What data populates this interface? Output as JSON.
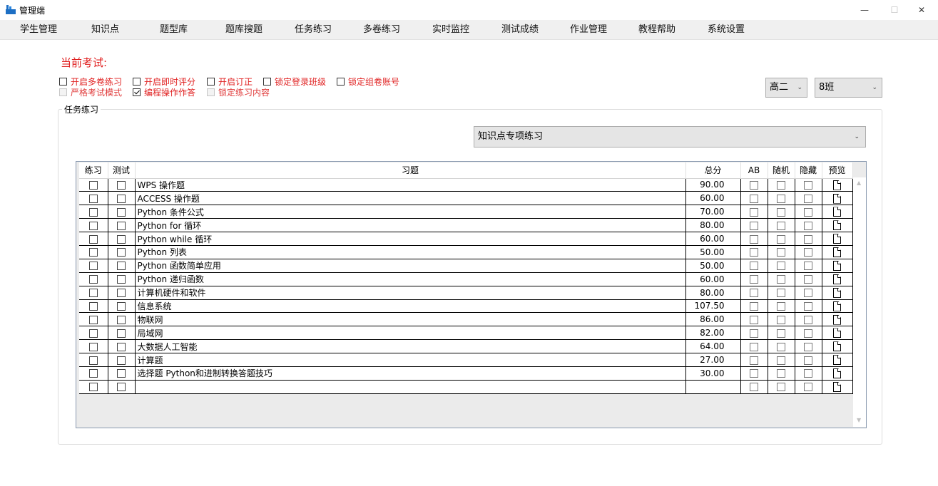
{
  "window": {
    "title": "管理端",
    "icon": "app-logo-icon",
    "min_glyph": "—",
    "max_glyph": "☐",
    "close_glyph": "✕"
  },
  "menu": [
    "学生管理",
    "知识点",
    "题型库",
    "题库搜题",
    "任务练习",
    "多卷练习",
    "实时监控",
    "测试成绩",
    "作业管理",
    "教程帮助",
    "系统设置"
  ],
  "exam": {
    "label": "当前考试:"
  },
  "options": [
    {
      "label": "开启多卷练习",
      "checked": false,
      "disabled": false
    },
    {
      "label": "开启即时评分",
      "checked": false,
      "disabled": false
    },
    {
      "label": "开启订正",
      "checked": false,
      "disabled": false
    },
    {
      "label": "锁定登录班级",
      "checked": false,
      "disabled": false
    },
    {
      "label": "锁定组卷账号",
      "checked": false,
      "disabled": false
    },
    {
      "label": "严格考试模式",
      "checked": false,
      "disabled": true
    },
    {
      "label": "编程操作作答",
      "checked": true,
      "disabled": false
    },
    {
      "label": "锁定练习内容",
      "checked": false,
      "disabled": true
    }
  ],
  "grade_select": {
    "value": "高二",
    "arrow": "⌄"
  },
  "class_select": {
    "value": "8班",
    "arrow": "⌄"
  },
  "group": {
    "title": "任务练习"
  },
  "type_select": {
    "value": "知识点专项练习",
    "arrow": "⌄"
  },
  "grid": {
    "headers": [
      "练习",
      "测试",
      "习题",
      "总分",
      "AB",
      "随机",
      "隐藏",
      "预览"
    ],
    "rows": [
      {
        "name": "WPS 操作题",
        "score": "90.00"
      },
      {
        "name": "ACCESS 操作题",
        "score": "60.00"
      },
      {
        "name": "Python 条件公式",
        "score": "70.00"
      },
      {
        "name": "Python for 循环",
        "score": "80.00"
      },
      {
        "name": "Python while 循环",
        "score": "60.00"
      },
      {
        "name": "Python 列表",
        "score": "50.00"
      },
      {
        "name": "Python 函数简单应用",
        "score": "50.00"
      },
      {
        "name": "Python 递归函数",
        "score": "60.00"
      },
      {
        "name": "计算机硬件和软件",
        "score": "80.00"
      },
      {
        "name": "信息系统",
        "score": "107.50"
      },
      {
        "name": "物联网",
        "score": "86.00"
      },
      {
        "name": "局域网",
        "score": "82.00"
      },
      {
        "name": "大数据人工智能",
        "score": "64.00"
      },
      {
        "name": "计算题",
        "score": "27.00"
      },
      {
        "name": "选择题 Python和进制转换答题技巧",
        "score": "30.00"
      },
      {
        "name": "",
        "score": ""
      }
    ],
    "scroll_up": "▲",
    "scroll_down": "▼"
  }
}
